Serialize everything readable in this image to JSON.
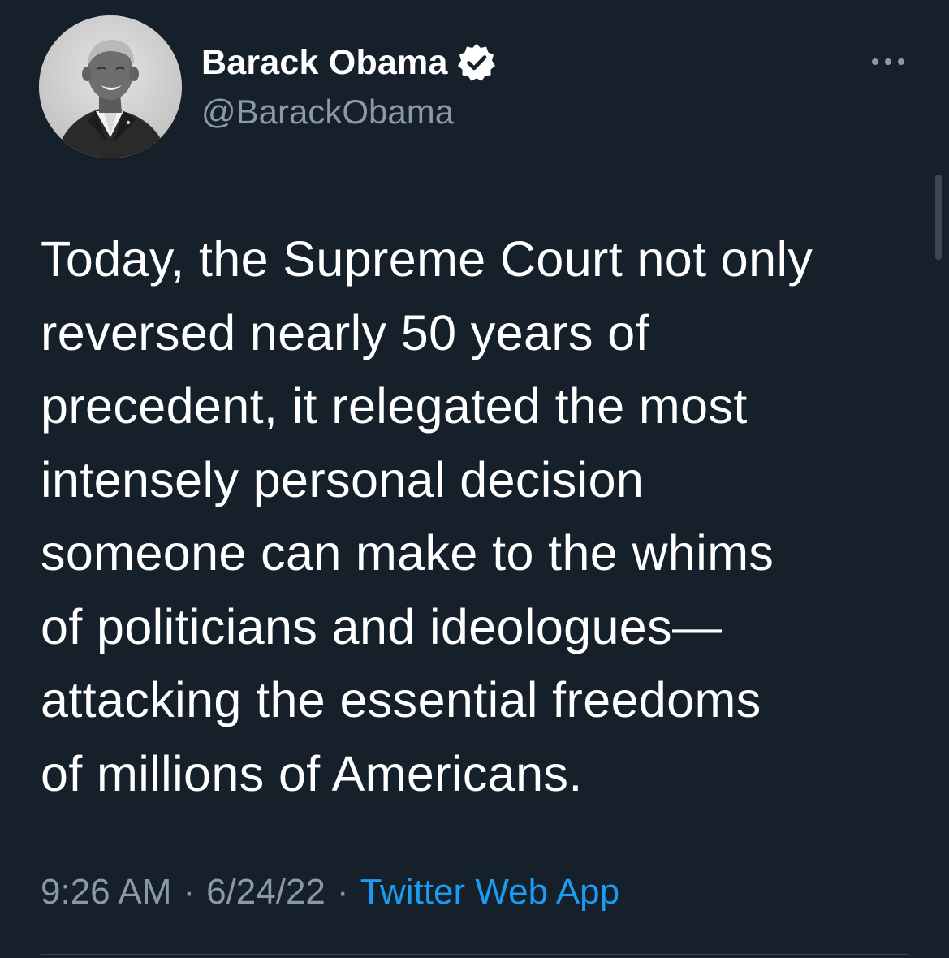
{
  "tweet": {
    "author": {
      "display_name": "Barack Obama",
      "handle": "@BarackObama",
      "verified": true
    },
    "text_lines": [
      "Today, the Supreme Court not only",
      "reversed nearly 50 years of",
      "precedent, it relegated the most",
      "intensely personal decision",
      "someone can make to the whims",
      "of politicians and ideologues—",
      "attacking the essential freedoms",
      "of millions of Americans."
    ],
    "meta": {
      "time": "9:26 AM",
      "separator": "·",
      "date": "6/24/22",
      "source": "Twitter Web App"
    }
  },
  "colors": {
    "background": "#15202b",
    "primary_text": "#ffffff",
    "secondary_text": "#8b98a5",
    "accent": "#1d9bf0",
    "divider": "#38444d"
  },
  "icons": {
    "verified": "verified-badge-icon",
    "more": "more-options-icon"
  }
}
